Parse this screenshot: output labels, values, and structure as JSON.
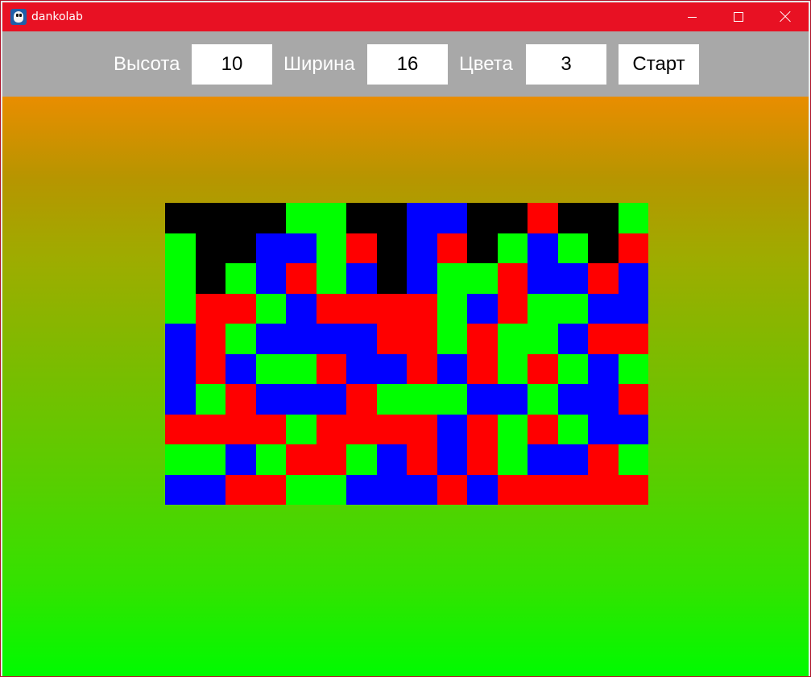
{
  "window": {
    "title": "dankolab",
    "controls": {
      "minimize": "minimize-icon",
      "maximize": "maximize-icon",
      "close": "close-icon"
    }
  },
  "toolbar": {
    "height_label": "Высота",
    "height_value": "10",
    "width_label": "Ширина",
    "width_value": "16",
    "colors_label": "Цвета",
    "colors_value": "3",
    "start_label": "Старт"
  },
  "colors": {
    "titlebar": "#e81123",
    "toolbar": "#a8a8a8",
    "gradient_top": "#e98d00",
    "gradient_bottom": "#00fb00"
  },
  "board": {
    "rows": 10,
    "cols": 16,
    "palette": {
      "K": "#000000",
      "G": "#00ff00",
      "B": "#0000ff",
      "R": "#ff0000"
    },
    "grid": [
      "KKKKGGKKBBKKRKKG",
      "GKKBBGRKBRKGBGKR",
      "GKGBRGBKBGGRBBRB",
      "GRRGBRRRRGBRGGBB",
      "BRGBBBBRRGRGGBRR",
      "BRBGGRBBRBRGRGBG",
      "BGRBBBRGGGBBGBBR",
      "RRRRGRRRRBRGRGBB",
      "GGBGRRGBRBRGBBRG",
      "BBRRGGBBBRBRRRRR"
    ]
  }
}
